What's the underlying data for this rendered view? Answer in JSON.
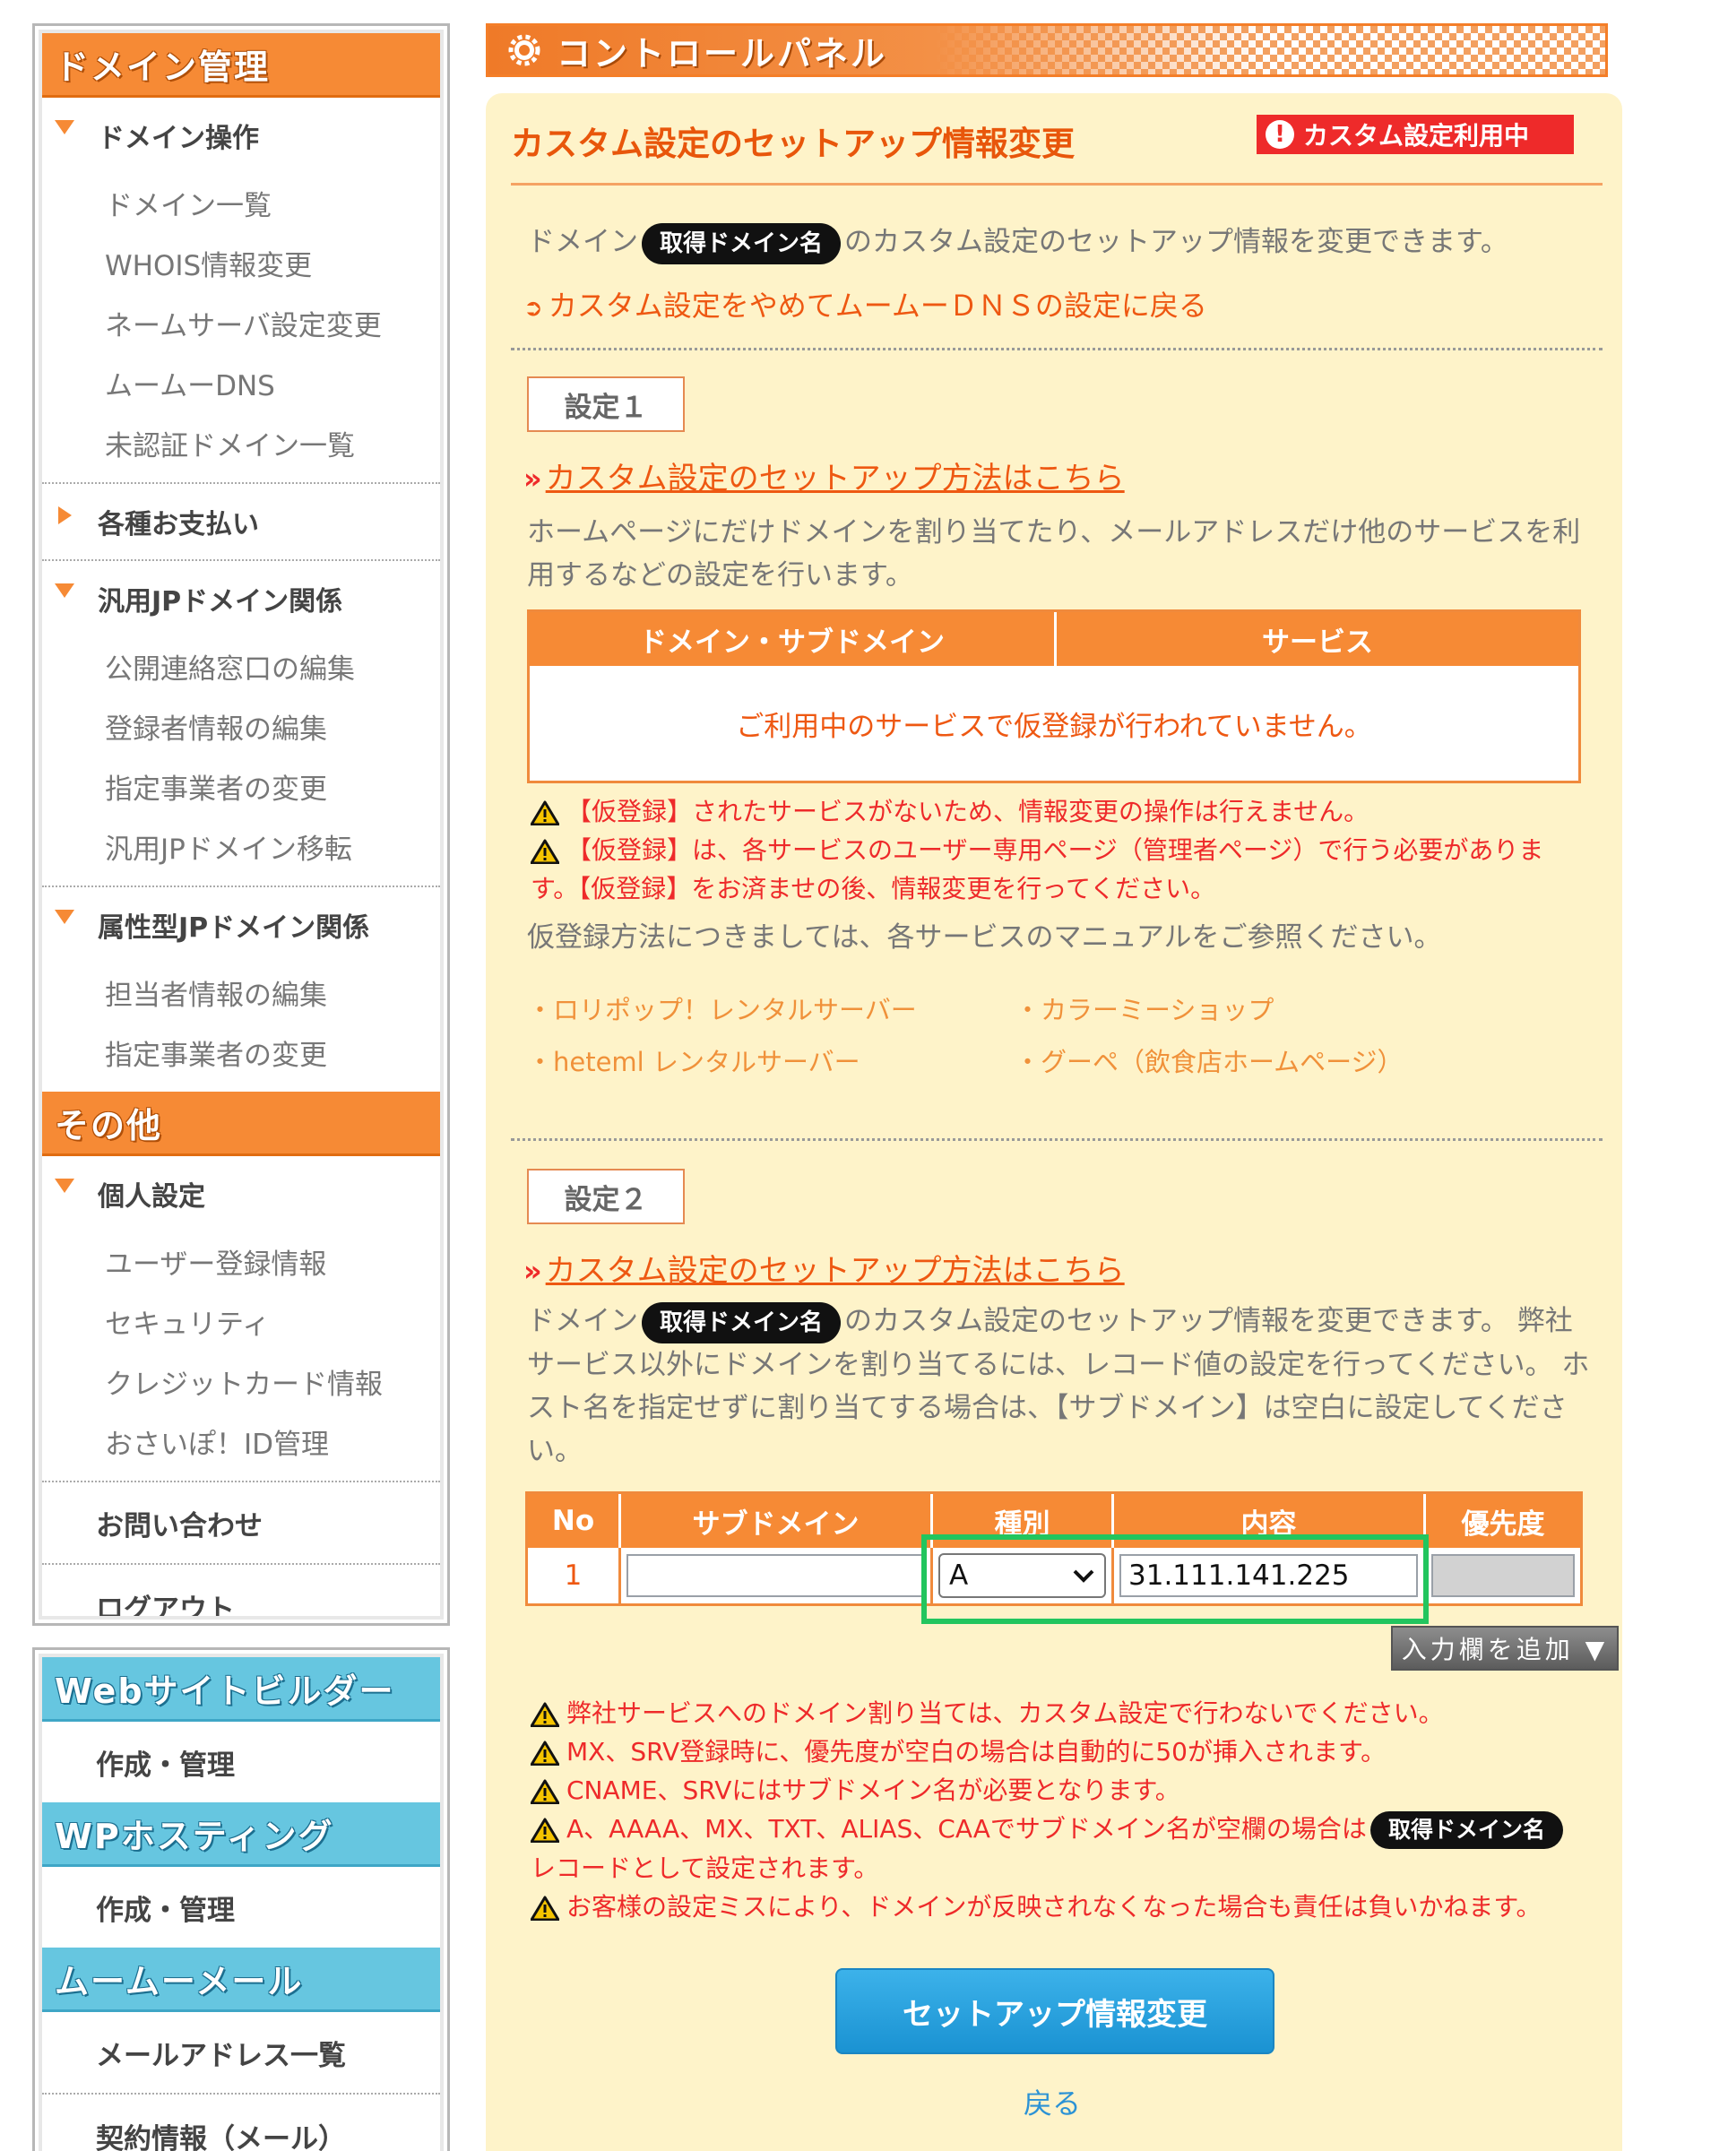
{
  "sidebar": {
    "domain_section": {
      "header": "ドメイン管理",
      "groups": [
        {
          "title": "ドメイン操作",
          "expanded": true,
          "items": [
            "ドメイン一覧",
            "WHOIS情報変更",
            "ネームサーバ設定変更",
            "ムームーDNS",
            "未認証ドメイン一覧"
          ]
        },
        {
          "title": "各種お支払い",
          "expanded": false,
          "items": []
        },
        {
          "title": "汎用JPドメイン関係",
          "expanded": true,
          "items": [
            "公開連絡窓口の編集",
            "登録者情報の編集",
            "指定事業者の変更",
            "汎用JPドメイン移転"
          ]
        },
        {
          "title": "属性型JPドメイン関係",
          "expanded": true,
          "items": [
            "担当者情報の編集",
            "指定事業者の変更"
          ]
        }
      ]
    },
    "other_section": {
      "header": "その他",
      "groups": [
        {
          "title": "個人設定",
          "expanded": true,
          "items": [
            "ユーザー登録情報",
            "セキュリティ",
            "クレジットカード情報",
            "おさいぽ！ID管理"
          ]
        }
      ],
      "links": [
        "お問い合わせ",
        "ログアウト"
      ]
    },
    "web_section": {
      "blocks": [
        {
          "header": "Webサイトビルダー",
          "link": "作成・管理"
        },
        {
          "header": "WPホスティング",
          "link": "作成・管理"
        },
        {
          "header": "ムームーメール",
          "link": "メールアドレス一覧"
        }
      ],
      "extra_link": "契約情報（メール）"
    }
  },
  "header": {
    "title": "コントロールパネル"
  },
  "main": {
    "title": "カスタム設定のセットアップ情報変更",
    "badge": "カスタム設定利用中",
    "intro_prefix": "ドメイン",
    "domain_pill": "取得ドメイン名",
    "intro_suffix": "のカスタム設定のセットアップ情報を変更できます。",
    "back_to_dns_link": "カスタム設定をやめてムームーＤＮＳの設定に戻る",
    "setting1": {
      "label": "設定１",
      "howto_link": "カスタム設定のセットアップ方法はこちら",
      "description": "ホームページにだけドメインを割り当てたり、メールアドレスだけ他のサービスを利用するなどの設定を行います。",
      "table_headers": [
        "ドメイン・サブドメイン",
        "サービス"
      ],
      "empty_message": "ご利用中のサービスで仮登録が行われていません。",
      "warnings": [
        "【仮登録】されたサービスがないため、情報変更の操作は行えません。",
        "【仮登録】は、各サービスのユーザー専用ページ（管理者ページ）で行う必要があります。【仮登録】をお済ませの後、情報変更を行ってください。"
      ],
      "manual_note": "仮登録方法につきましては、各サービスのマニュアルをご参照ください。",
      "services": [
        "・ロリポップ！レンタルサーバー",
        "・カラーミーショップ",
        "・heteml レンタルサーバー",
        "・グーペ（飲食店ホームページ）"
      ]
    },
    "setting2": {
      "label": "設定２",
      "howto_link": "カスタム設定のセットアップ方法はこちら",
      "desc_prefix": "ドメイン",
      "desc_suffix": "のカスタム設定のセットアップ情報を変更できます。 弊社サービス以外にドメインを割り当てるには、レコード値の設定を行ってください。 ホスト名を指定せずに割り当てする場合は、【サブドメイン】は空白に設定してください。",
      "table_headers": [
        "No",
        "サブドメイン",
        "種別",
        "内容",
        "優先度"
      ],
      "rows": [
        {
          "no": "1",
          "subdomain": "",
          "type": "A",
          "content": "31.111.141.225",
          "priority": ""
        }
      ],
      "add_row_button": "入力欄を追加 ▼",
      "warnings": [
        "弊社サービスへのドメイン割り当ては、カスタム設定で行わないでください。",
        "MX、SRV登録時に、優先度が空白の場合は自動的に50が挿入されます。",
        "CNAME、SRVにはサブドメイン名が必要となります。",
        "A、AAAA、MX、TXT、ALIAS、CAAでサブドメイン名が空欄の場合は",
        "レコードとして設定されます。",
        "お客様の設定ミスにより、ドメインが反映されなくなった場合も責任は負いかねます。"
      ]
    },
    "submit_button": "セットアップ情報変更",
    "back_link": "戻る"
  },
  "colors": {
    "orange": "#f68a35",
    "red": "#ee2a2a",
    "panel_bg": "#fef3c9",
    "blue_button": "#1a92d2",
    "highlight": "#22c55e"
  }
}
